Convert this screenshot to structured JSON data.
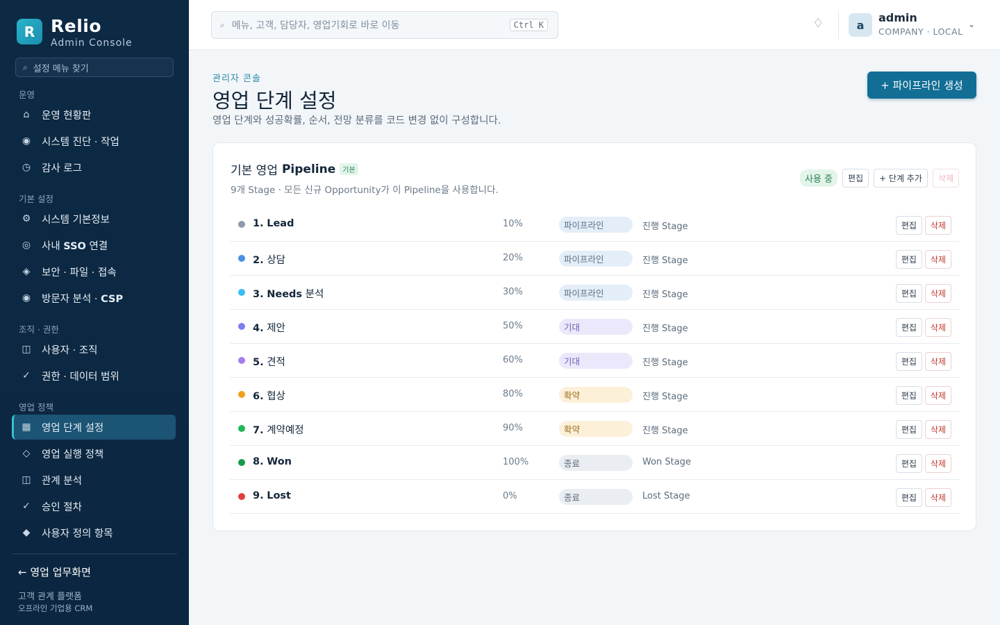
{
  "brand": {
    "logo_letter": "R",
    "name": "Relio",
    "subtitle": "Admin Console"
  },
  "sidebar": {
    "search_placeholder": "설정 메뉴 찾기",
    "sections": [
      {
        "label": "운영",
        "items": [
          {
            "label": "운영 현황판",
            "icon": "home-icon",
            "glyph": "⌂"
          },
          {
            "label": "시스템 진단 · 작업",
            "icon": "circle-dot-icon",
            "glyph": "◉"
          },
          {
            "label": "감사 로그",
            "icon": "clock-icon",
            "glyph": "◷"
          }
        ]
      },
      {
        "label": "기본 설정",
        "items": [
          {
            "label": "시스템 기본정보",
            "icon": "gear-icon",
            "glyph": "⚙"
          },
          {
            "label_prefix": "사내 ",
            "label_bold": "SSO",
            "label_suffix": " 연결",
            "icon": "target-icon",
            "glyph": "◎"
          },
          {
            "label": "보안 · 파일 · 접속",
            "icon": "diamond-icon",
            "glyph": "◈"
          },
          {
            "label_prefix": "방문자 분석 · ",
            "label_bold": "CSP",
            "label_suffix": "",
            "icon": "circle-dot-icon",
            "glyph": "◉"
          }
        ]
      },
      {
        "label": "조직 · 권한",
        "items": [
          {
            "label": "사용자 · 조직",
            "icon": "panel-icon",
            "glyph": "◫"
          },
          {
            "label": "권한 · 데이터 범위",
            "icon": "check-icon",
            "glyph": "✓"
          }
        ]
      },
      {
        "label": "영업 정책",
        "items": [
          {
            "label": "영업 단계 설정",
            "icon": "grid-icon",
            "glyph": "▦",
            "active": true
          },
          {
            "label": "영업 실행 정책",
            "icon": "diamond-outline-icon",
            "glyph": "◇"
          },
          {
            "label": "관계 분석",
            "icon": "panel-icon",
            "glyph": "◫"
          },
          {
            "label": "승인 절차",
            "icon": "check-icon",
            "glyph": "✓"
          },
          {
            "label": "사용자 정의 항목",
            "icon": "diamond-solid-icon",
            "glyph": "◆"
          }
        ]
      }
    ],
    "back_link": "← 영업 업무화면",
    "footer_line1": "고객 관계 플랫폼",
    "footer_line2": "오프라인 기업용 CRM"
  },
  "topbar": {
    "search_placeholder": "메뉴, 고객, 담당자, 영업기회로 바로 이동",
    "shortcut": "Ctrl K",
    "user_initial": "a",
    "user_name": "admin",
    "user_sub": "COMPANY · LOCAL"
  },
  "page": {
    "breadcrumb": "관리자 콘솔",
    "title": "영업 단계 설정",
    "description": "영업 단계와 성공확률, 순서, 전망 분류를 코드 변경 없이 구성합니다.",
    "create_button": "+ 파이프라인 생성"
  },
  "pipeline": {
    "title_prefix": "기본 영업",
    "title_bold": "Pipeline",
    "default_tag": "기본",
    "subtitle": "9개 Stage · 모든 신규 Opportunity가 이 Pipeline을 사용합니다.",
    "status": "사용 중",
    "edit_label": "편집",
    "add_stage_label": "+ 단계 추가",
    "delete_label": "삭제",
    "row_edit_label": "편집",
    "row_delete_label": "삭제",
    "stages": [
      {
        "num": "1.",
        "name": "Lead",
        "name_bold": true,
        "probability": "10%",
        "category": "파이프라인",
        "type": "진행 Stage",
        "dot": "#8e9aab",
        "cat_bg": "#e4eef8",
        "cat_fg": "#5a6f86"
      },
      {
        "num": "2.",
        "name": "상담",
        "name_bold": false,
        "probability": "20%",
        "category": "파이프라인",
        "type": "진행 Stage",
        "dot": "#4a90e2",
        "cat_bg": "#e4eef8",
        "cat_fg": "#5a6f86"
      },
      {
        "num": "3.",
        "name": "Needs",
        "name_suffix": " 분석",
        "name_bold": true,
        "probability": "30%",
        "category": "파이프라인",
        "type": "진행 Stage",
        "dot": "#38bdf8",
        "cat_bg": "#e4eef8",
        "cat_fg": "#5a6f86"
      },
      {
        "num": "4.",
        "name": "제안",
        "name_bold": false,
        "probability": "50%",
        "category": "기대",
        "type": "진행 Stage",
        "dot": "#7c7ff0",
        "cat_bg": "#ece8fb",
        "cat_fg": "#6b5fae"
      },
      {
        "num": "5.",
        "name": "견적",
        "name_bold": false,
        "probability": "60%",
        "category": "기대",
        "type": "진행 Stage",
        "dot": "#a77bf0",
        "cat_bg": "#ece8fb",
        "cat_fg": "#6b5fae"
      },
      {
        "num": "6.",
        "name": "협상",
        "name_bold": false,
        "probability": "80%",
        "category": "확약",
        "type": "진행 Stage",
        "dot": "#f0a01b",
        "cat_bg": "#fdf0d9",
        "cat_fg": "#9a6a1c"
      },
      {
        "num": "7.",
        "name": "계약예정",
        "name_bold": false,
        "probability": "90%",
        "category": "확약",
        "type": "진행 Stage",
        "dot": "#22b85a",
        "cat_bg": "#fdf0d9",
        "cat_fg": "#9a6a1c"
      },
      {
        "num": "8.",
        "name": "Won",
        "name_bold": true,
        "probability": "100%",
        "category": "종료",
        "type": "Won Stage",
        "dot": "#169a4a",
        "cat_bg": "#eaedf1",
        "cat_fg": "#5b6b7b"
      },
      {
        "num": "9.",
        "name": "Lost",
        "name_bold": true,
        "probability": "0%",
        "category": "종료",
        "type": "Lost Stage",
        "dot": "#e53e3e",
        "cat_bg": "#eaedf1",
        "cat_fg": "#5b6b7b"
      }
    ]
  },
  "colors": {
    "sidebar_bg": "#0d2a44",
    "accent": "#126e95",
    "active_item": "#1b5474",
    "active_border": "#34c2d6"
  }
}
